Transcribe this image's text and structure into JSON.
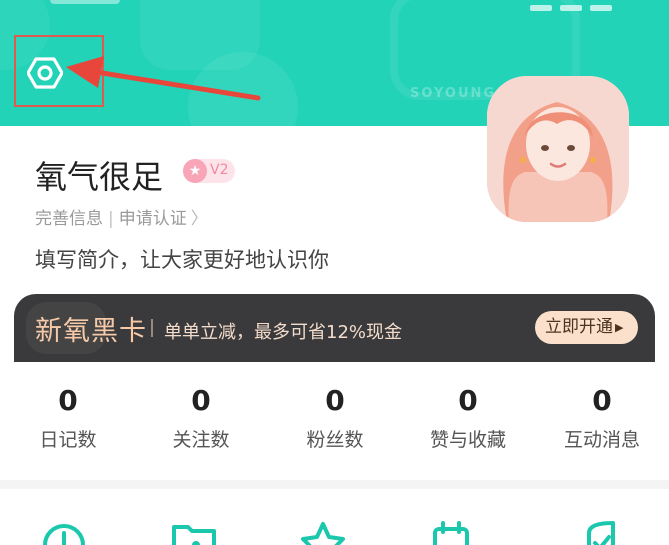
{
  "header": {
    "brand_watermark": "SOYOUNG",
    "accent_color": "#22d3b8",
    "settings_icon": "gear-hexagon-icon",
    "annotation_color": "#e05a4f"
  },
  "profile": {
    "nickname": "氧气很足",
    "level": "V2",
    "level_star": "★",
    "link_complete": "完善信息",
    "separator": "|",
    "link_verify": "申请认证",
    "chevron": "〉",
    "bio": "填写简介，让大家更好地认识你",
    "avatar_icon": "illustrated-avatar"
  },
  "vip_card": {
    "title": "新氧黑卡",
    "description": "单单立减，最多可省12%现金",
    "button_label": "立即开通",
    "button_arrow": "▶"
  },
  "stats": [
    {
      "value": "0",
      "label": "日记数"
    },
    {
      "value": "0",
      "label": "关注数"
    },
    {
      "value": "0",
      "label": "粉丝数"
    },
    {
      "value": "0",
      "label": "赞与收藏"
    },
    {
      "value": "0",
      "label": "互动消息"
    }
  ],
  "shortcuts": [
    {
      "icon": "clock-icon"
    },
    {
      "icon": "folder-icon"
    },
    {
      "icon": "star-icon"
    },
    {
      "icon": "calendar-icon"
    },
    {
      "icon": "shield-check-icon"
    }
  ]
}
